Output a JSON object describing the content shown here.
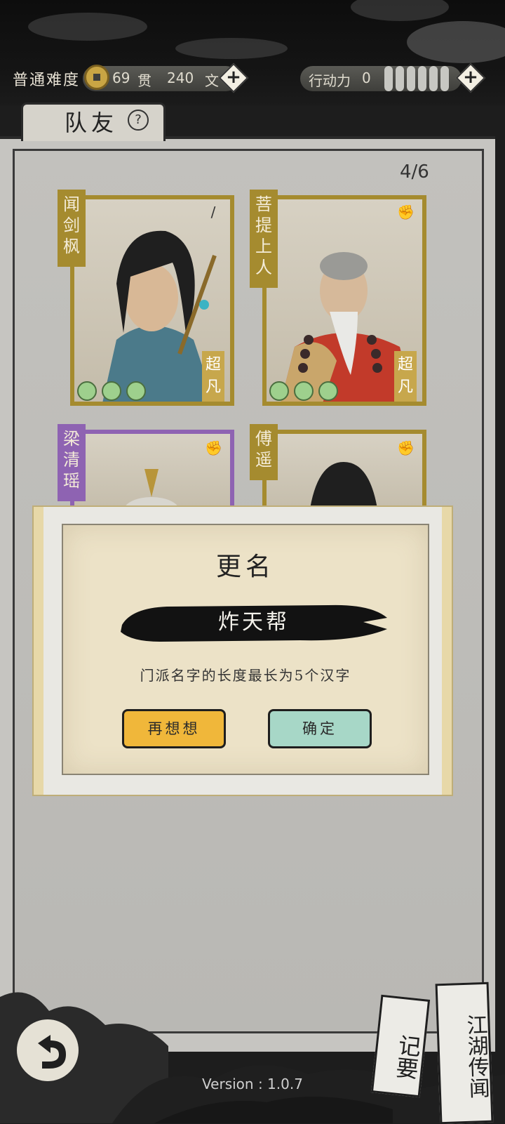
{
  "header": {
    "difficulty": "普通难度",
    "coins_guan": "69",
    "guan_unit": "贯",
    "coins_wen": "240",
    "wen_unit": "文",
    "action_label": "行动力",
    "action_value": "0",
    "plus": "+"
  },
  "tab": {
    "label": "队友",
    "help": "?"
  },
  "roster_count": "4/6",
  "cards": [
    {
      "name": "闻剑枫",
      "rank": "超凡",
      "hearts": 3,
      "weapon_icon": "sword-icon",
      "frame_color": "#a58b2f"
    },
    {
      "name": "菩提上人",
      "rank": "超凡",
      "hearts": 3,
      "weapon_icon": "fist-icon",
      "frame_color": "#a58b2f"
    },
    {
      "name": "梁清瑶",
      "rank": "",
      "hearts": 0,
      "weapon_icon": "fist-icon",
      "frame_color": "#8e63b2"
    },
    {
      "name": "傅遥",
      "rank": "",
      "hearts": 0,
      "weapon_icon": "fist-icon",
      "frame_color": "#a58b2f"
    }
  ],
  "dialog": {
    "title": "更名",
    "name_value": "炸天帮",
    "hint": "门派名字的长度最长为5个汉字",
    "cancel_label": "再想想",
    "confirm_label": "确定"
  },
  "footer": {
    "version": "Version : 1.0.7",
    "notes_label": "记要",
    "rumors_label": "江湖传闻",
    "back_icon": "back-arrow-icon"
  },
  "colors": {
    "gold": "#a58b2f",
    "purple": "#8e63b2",
    "cancel": "#f0b73a",
    "confirm": "#a7d7c7"
  }
}
